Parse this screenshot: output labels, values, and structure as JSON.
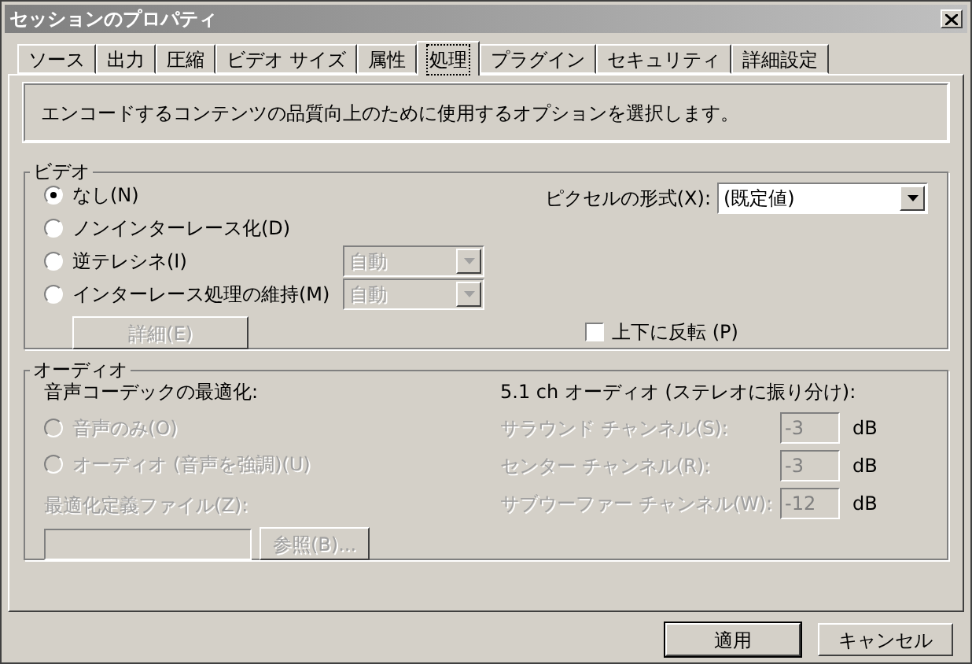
{
  "window": {
    "title": "セッションのプロパティ"
  },
  "tabs": [
    {
      "label": "ソース",
      "selected": false
    },
    {
      "label": "出力",
      "selected": false
    },
    {
      "label": "圧縮",
      "selected": false
    },
    {
      "label": "ビデオ サイズ",
      "selected": false
    },
    {
      "label": "属性",
      "selected": false
    },
    {
      "label": "処理",
      "selected": true
    },
    {
      "label": "プラグイン",
      "selected": false
    },
    {
      "label": "セキュリティ",
      "selected": false
    },
    {
      "label": "詳細設定",
      "selected": false
    }
  ],
  "description": "エンコードするコンテンツの品質向上のために使用するオプションを選択します。",
  "video": {
    "legend": "ビデオ",
    "options": [
      {
        "label": "なし(N)",
        "selected": true
      },
      {
        "label": "ノンインターレース化(D)",
        "selected": false
      },
      {
        "label": "逆テレシネ(I)",
        "selected": false,
        "combo": {
          "value": "自動",
          "disabled": true
        }
      },
      {
        "label": "インターレース処理の維持(M)",
        "selected": false,
        "combo": {
          "value": "自動",
          "disabled": true
        }
      }
    ],
    "detail_button": {
      "label": "詳細(E)",
      "disabled": true
    },
    "pixel_format": {
      "label": "ピクセルの形式(X):",
      "value": "(既定値)"
    },
    "flip": {
      "label": "上下に反転 (P)",
      "checked": false
    }
  },
  "audio": {
    "legend": "オーディオ",
    "codec_label": "音声コーデックの最適化:",
    "options": [
      {
        "label": "音声のみ(O)",
        "selected": false,
        "disabled": true
      },
      {
        "label": "オーディオ (音声を強調)(U)",
        "selected": false,
        "disabled": true
      }
    ],
    "profile_label": {
      "text": "最適化定義ファイル(Z):",
      "disabled": true
    },
    "browse_button": {
      "label": "参照(B)...",
      "disabled": true
    },
    "surround_heading": "5.1 ch オーディオ (ステレオに振り分け):",
    "channels": [
      {
        "label": "サラウンド チャンネル(S):",
        "value": "-3",
        "unit": "dB",
        "disabled": true
      },
      {
        "label": "センター チャンネル(R):",
        "value": "-3",
        "unit": "dB",
        "disabled": true
      },
      {
        "label": "サブウーファー チャンネル(W):",
        "value": "-12",
        "unit": "dB",
        "disabled": true
      }
    ]
  },
  "buttons": [
    {
      "label": "適用",
      "default": true
    },
    {
      "label": "キャンセル",
      "default": false
    }
  ]
}
